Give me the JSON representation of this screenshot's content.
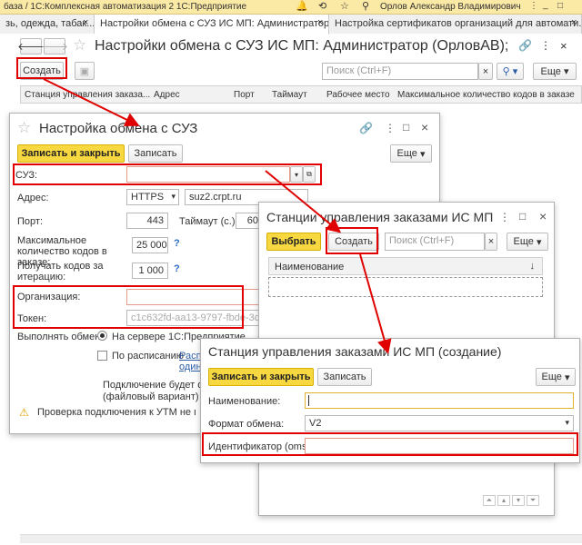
{
  "title_bar": {
    "text": "база / 1С:Комплексная автоматизация 2 1С:Предприятие",
    "user": "Орлов Александр Владимирович"
  },
  "tabs": [
    {
      "label": "зь, одежда, табак...)",
      "close": "×"
    },
    {
      "label": "Настройки обмена с СУЗ ИС МП: Администратор (...",
      "close": "×"
    },
    {
      "label": "Настройка сертификатов организаций для автомати...",
      "close": "×"
    }
  ],
  "main": {
    "title": "Настройки обмена с СУЗ ИС МП: Администратор (ОрловАВ); Орлов А...",
    "create": "Создать",
    "search_placeholder": "Поиск (Ctrl+F)",
    "more": "Еще",
    "columns": [
      "Станция управления заказа...",
      "Адрес",
      "Порт",
      "Таймаут",
      "Рабочее место",
      "Максимальное количество кодов в заказе"
    ]
  },
  "suz": {
    "title": "Настройка обмена с СУЗ",
    "save_close": "Записать и закрыть",
    "save": "Записать",
    "more": "Еще",
    "suz_label": "СУЗ:",
    "address_label": "Адрес:",
    "protocol": "HTTPS",
    "host": "suz2.crpt.ru",
    "port_label": "Порт:",
    "port": "443",
    "timeout_label": "Таймаут (с.):",
    "timeout": "60",
    "max_label": "Максимальное количество кодов в заказе:",
    "max_value": "25 000",
    "get_label": "Получать кодов за итерацию:",
    "get_value": "1 000",
    "help": "?",
    "org_label": "Организация:",
    "token_label": "Токен:",
    "token_value": "c1c632fd-aa13-9797-fbde-3d43751c",
    "exec_label": "Выполнять обмен:",
    "on_server": "На сервере 1С:Предприятие",
    "by_schedule": "По расписанию",
    "schedule_link": "Распи",
    "schedule_link2": "один",
    "connect_note": "Подключение будет осущ",
    "file_variant": "(файловый вариант)",
    "warning": "Проверка подключения к УТМ не выполн"
  },
  "stations": {
    "title": "Станции управления заказами ИС МП",
    "select": "Выбрать",
    "create": "Создать",
    "search_placeholder": "Поиск (Ctrl+F)",
    "more": "Еще",
    "col_name": "Наименование"
  },
  "create_form": {
    "title": "Станция управления заказами ИС МП (создание)",
    "save_close": "Записать и закрыть",
    "save": "Записать",
    "more": "Еще",
    "name_label": "Наименование:",
    "format_label": "Формат обмена:",
    "format_value": "V2",
    "id_label": "Идентификатор (omsId):"
  }
}
